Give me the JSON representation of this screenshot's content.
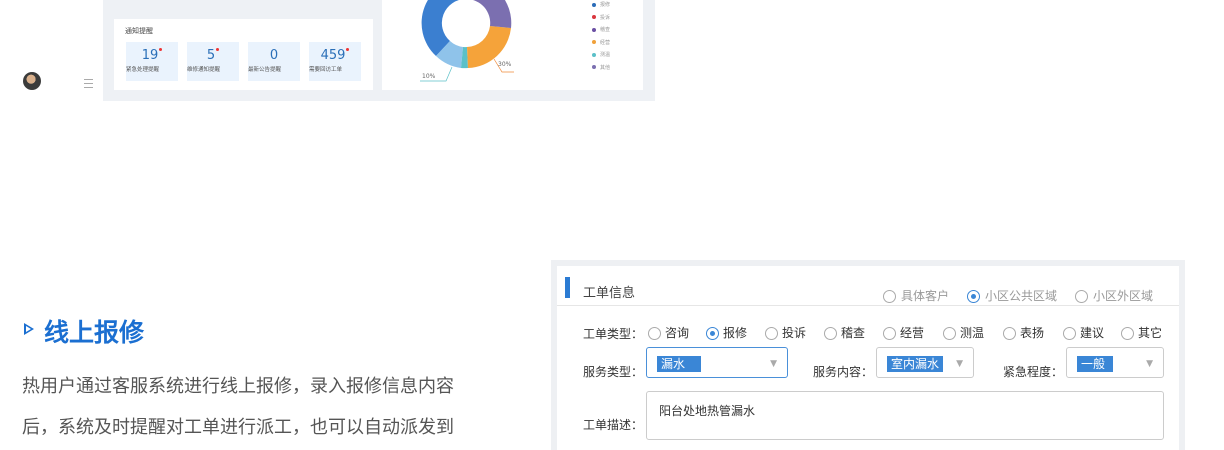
{
  "dashboard": {
    "notice_title": "通知提醒",
    "stats": [
      {
        "value": "19",
        "label": "紧急处理提醒",
        "flag": true
      },
      {
        "value": "5",
        "label": "维修通知提醒",
        "flag": true
      },
      {
        "value": "0",
        "label": "最新公告提醒",
        "flag": false
      },
      {
        "value": "459",
        "label": "需要回访工单",
        "flag": true
      }
    ],
    "donut": {
      "pct_labels": [
        "30%",
        "10%"
      ],
      "legend": [
        {
          "name": "报修",
          "color": "#2b6cb8"
        },
        {
          "name": "投诉",
          "color": "#d9363e"
        },
        {
          "name": "稽查",
          "color": "#6a4fa3"
        },
        {
          "name": "经营",
          "color": "#f0a13a"
        },
        {
          "name": "测温",
          "color": "#5bc0c8"
        },
        {
          "name": "其他",
          "color": "#7b6fb0"
        }
      ]
    }
  },
  "feature": {
    "title": "线上报修",
    "desc_line1": "热用户通过客服系统进行线上报修，录入报修信息内容",
    "desc_line2": "后，系统及时提醒对工单进行派工，也可以自动派发到"
  },
  "form": {
    "section_title": "工单信息",
    "scope_options": [
      {
        "label": "具体客户",
        "checked": false
      },
      {
        "label": "小区公共区域",
        "checked": true
      },
      {
        "label": "小区外区域",
        "checked": false
      }
    ],
    "type_label": "工单类型：",
    "type_options": [
      {
        "label": "咨询",
        "checked": false
      },
      {
        "label": "报修",
        "checked": true
      },
      {
        "label": "投诉",
        "checked": false
      },
      {
        "label": "稽查",
        "checked": false
      },
      {
        "label": "经营",
        "checked": false
      },
      {
        "label": "测温",
        "checked": false
      },
      {
        "label": "表扬",
        "checked": false
      },
      {
        "label": "建议",
        "checked": false
      },
      {
        "label": "其它",
        "checked": false
      }
    ],
    "service_type_label": "服务类型：",
    "service_type_value": "漏水",
    "service_content_label": "服务内容：",
    "service_content_value": "室内漏水",
    "urgency_label": "紧急程度：",
    "urgency_value": "一般",
    "desc_label": "工单描述：",
    "desc_value": "阳台处地热管漏水"
  }
}
